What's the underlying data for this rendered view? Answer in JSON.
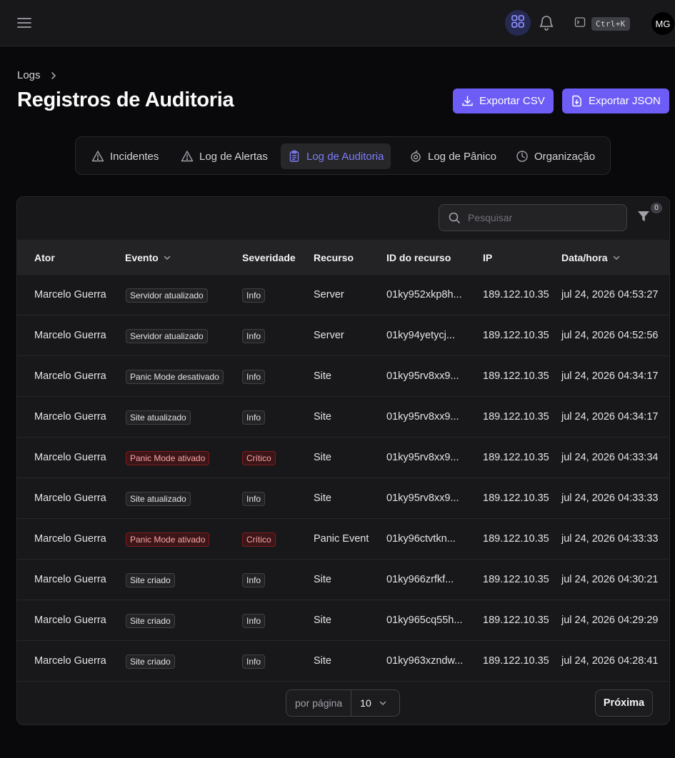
{
  "header": {
    "shortcut": "Ctrl+K",
    "avatar_initials": "MG"
  },
  "breadcrumb": {
    "root": "Logs"
  },
  "page": {
    "title": "Registros de Auditoria",
    "export_csv": "Exportar CSV",
    "export_json": "Exportar JSON"
  },
  "tabs": [
    {
      "label": "Incidentes",
      "icon": "warning-icon"
    },
    {
      "label": "Log de Alertas",
      "icon": "warning-icon"
    },
    {
      "label": "Log de Auditoria",
      "icon": "clipboard-icon",
      "active": true
    },
    {
      "label": "Log de Pânico",
      "icon": "panic-icon"
    },
    {
      "label": "Organização",
      "icon": "clock-icon"
    }
  ],
  "search": {
    "placeholder": "Pesquisar"
  },
  "filter": {
    "count": "0"
  },
  "table": {
    "columns": {
      "actor": "Ator",
      "event": "Evento",
      "severity": "Severidade",
      "resource": "Recurso",
      "resource_id": "ID do recurso",
      "ip": "IP",
      "datetime": "Data/hora"
    },
    "rows": [
      {
        "actor": "Marcelo Guerra",
        "event": "Servidor atualizado",
        "event_critical": false,
        "severity": "Info",
        "severity_critical": false,
        "resource": "Server",
        "resource_id": "01ky952xkp8h...",
        "ip": "189.122.10.35",
        "datetime": "jul 24, 2026 04:53:27"
      },
      {
        "actor": "Marcelo Guerra",
        "event": "Servidor atualizado",
        "event_critical": false,
        "severity": "Info",
        "severity_critical": false,
        "resource": "Server",
        "resource_id": "01ky94yetycj...",
        "ip": "189.122.10.35",
        "datetime": "jul 24, 2026 04:52:56"
      },
      {
        "actor": "Marcelo Guerra",
        "event": "Panic Mode desativado",
        "event_critical": false,
        "severity": "Info",
        "severity_critical": false,
        "resource": "Site",
        "resource_id": "01ky95rv8xx9...",
        "ip": "189.122.10.35",
        "datetime": "jul 24, 2026 04:34:17"
      },
      {
        "actor": "Marcelo Guerra",
        "event": "Site atualizado",
        "event_critical": false,
        "severity": "Info",
        "severity_critical": false,
        "resource": "Site",
        "resource_id": "01ky95rv8xx9...",
        "ip": "189.122.10.35",
        "datetime": "jul 24, 2026 04:34:17"
      },
      {
        "actor": "Marcelo Guerra",
        "event": "Panic Mode ativado",
        "event_critical": true,
        "severity": "Crítico",
        "severity_critical": true,
        "resource": "Site",
        "resource_id": "01ky95rv8xx9...",
        "ip": "189.122.10.35",
        "datetime": "jul 24, 2026 04:33:34"
      },
      {
        "actor": "Marcelo Guerra",
        "event": "Site atualizado",
        "event_critical": false,
        "severity": "Info",
        "severity_critical": false,
        "resource": "Site",
        "resource_id": "01ky95rv8xx9...",
        "ip": "189.122.10.35",
        "datetime": "jul 24, 2026 04:33:33"
      },
      {
        "actor": "Marcelo Guerra",
        "event": "Panic Mode ativado",
        "event_critical": true,
        "severity": "Crítico",
        "severity_critical": true,
        "resource": "Panic Event",
        "resource_id": "01ky96ctvtkn...",
        "ip": "189.122.10.35",
        "datetime": "jul 24, 2026 04:33:33"
      },
      {
        "actor": "Marcelo Guerra",
        "event": "Site criado",
        "event_critical": false,
        "severity": "Info",
        "severity_critical": false,
        "resource": "Site",
        "resource_id": "01ky966zrfkf...",
        "ip": "189.122.10.35",
        "datetime": "jul 24, 2026 04:30:21"
      },
      {
        "actor": "Marcelo Guerra",
        "event": "Site criado",
        "event_critical": false,
        "severity": "Info",
        "severity_critical": false,
        "resource": "Site",
        "resource_id": "01ky965cq55h...",
        "ip": "189.122.10.35",
        "datetime": "jul 24, 2026 04:29:29"
      },
      {
        "actor": "Marcelo Guerra",
        "event": "Site criado",
        "event_critical": false,
        "severity": "Info",
        "severity_critical": false,
        "resource": "Site",
        "resource_id": "01ky963xzndw...",
        "ip": "189.122.10.35",
        "datetime": "jul 24, 2026 04:28:41"
      }
    ]
  },
  "pagination": {
    "per_page_label": "por página",
    "per_page_value": "10",
    "next": "Próxima"
  },
  "colors": {
    "accent": "#6d5cf6",
    "active_tab_text": "#7c7cf8",
    "critical_text": "#fca5a5",
    "background": "#09090b",
    "surface": "#18181b"
  }
}
